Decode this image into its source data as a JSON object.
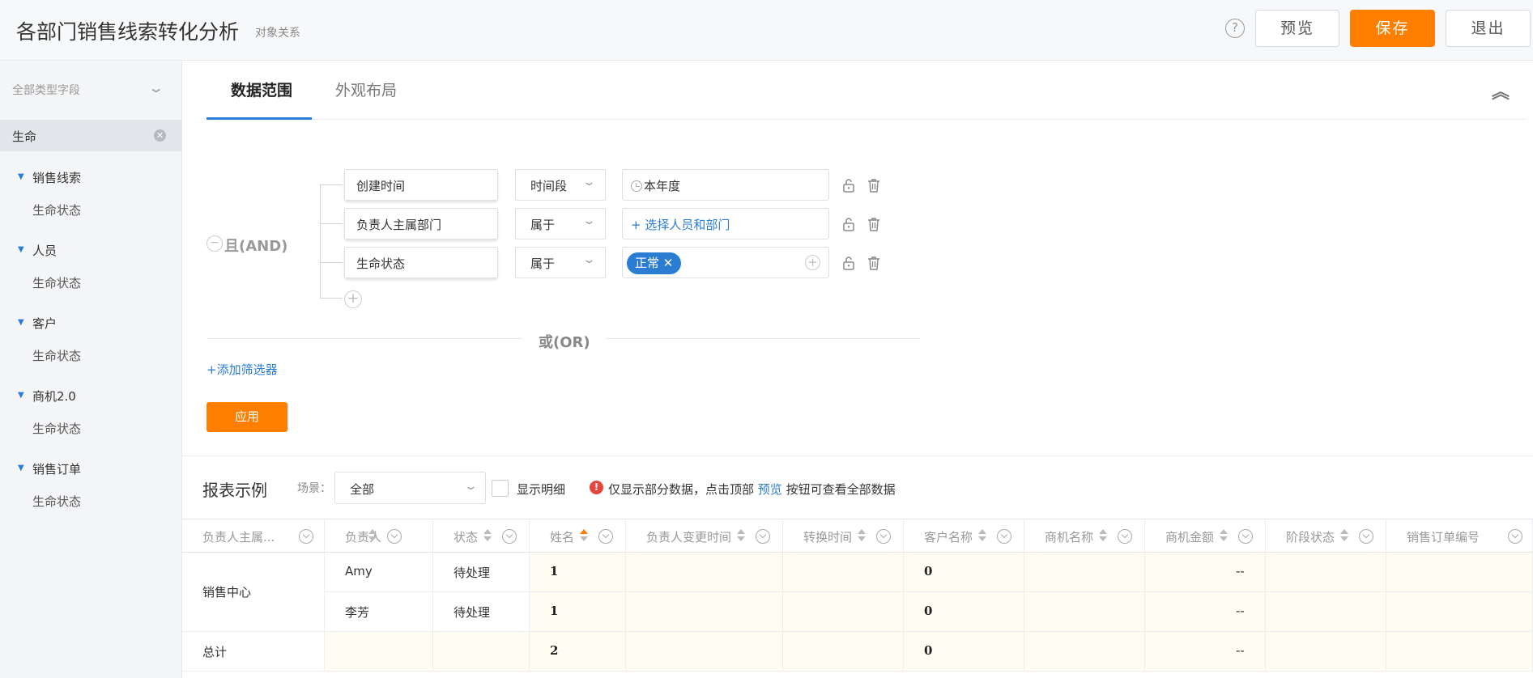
{
  "header": {
    "title": "各部门销售线索转化分析",
    "subtitle": "对象关系",
    "help": "?",
    "preview_label": "预览",
    "save_label": "保存",
    "exit_label": "退出",
    "accent_color": "#ff7e00"
  },
  "sidebar": {
    "field_type_select": "全部类型字段",
    "search_value": "生命",
    "groups": [
      {
        "label": "销售线索",
        "child": "生命状态"
      },
      {
        "label": "人员",
        "child": "生命状态"
      },
      {
        "label": "客户",
        "child": "生命状态"
      },
      {
        "label": "商机2.0",
        "child": "生命状态"
      },
      {
        "label": "销售订单",
        "child": "生命状态"
      }
    ]
  },
  "tabs": {
    "active": "数据范围",
    "inactive": "外观布局"
  },
  "filter": {
    "and_label": "且(AND)",
    "conditions": [
      {
        "field": "创建时间",
        "operator": "时间段",
        "value": "本年度"
      },
      {
        "field": "负责人主属部门",
        "operator": "属于",
        "value": "+ 选择人员和部门"
      },
      {
        "field": "生命状态",
        "operator": "属于",
        "value": "正常 ✕"
      }
    ],
    "or_label": "或(OR)",
    "add_filter": "+添加筛选器",
    "apply_label": "应用"
  },
  "report": {
    "title": "报表示例",
    "scene_label": "场景：",
    "scene_value": "全部",
    "show_detail": "显示明细",
    "warn_icon": "!",
    "warn_text_1": "仅显示部分数据，点击顶部 ",
    "warn_link": "预览",
    "warn_text_2": " 按钮可查看全部数据",
    "columns": [
      "负责人主属...",
      "负责人",
      "状态",
      "姓名",
      "负责人变更时间",
      "转换时间",
      "客户名称",
      "商机名称",
      "商机金额",
      "阶段状态",
      "销售订单编号"
    ],
    "group_label": "销售中心",
    "rows": [
      {
        "owner": "Amy",
        "status": "待处理",
        "name": "1",
        "customer": "0",
        "amount": "--"
      },
      {
        "owner": "李芳",
        "status": "待处理",
        "name": "1",
        "customer": "0",
        "amount": "--"
      }
    ],
    "total": {
      "label": "总计",
      "name": "2",
      "customer": "0",
      "amount": "--"
    }
  }
}
